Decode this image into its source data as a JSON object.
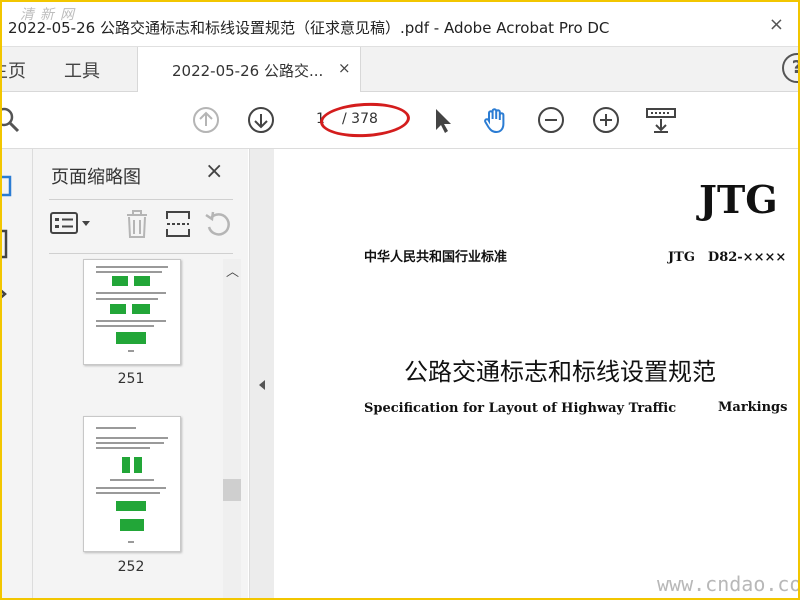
{
  "window": {
    "site_logo": "清新网",
    "title": "2022-05-26 公路交通标志和标线设置规范（征求意见稿）.pdf - Adobe Acrobat Pro DC",
    "close_symbol": "×"
  },
  "tabs": {
    "home": "主页",
    "tools": "工具",
    "document": "2022-05-26 公路交...",
    "close_symbol": "×",
    "help_symbol": "?"
  },
  "toolbar": {
    "page_current": "1",
    "page_total": "/ 378",
    "icons": [
      "search-icon",
      "prev-page-icon",
      "next-page-icon",
      "select-cursor-icon",
      "hand-tool-icon",
      "zoom-out-icon",
      "zoom-in-icon",
      "page-display-icon"
    ]
  },
  "thumbnails": {
    "title": "页面缩略图",
    "close_symbol": "×",
    "tools": [
      "options-menu-icon",
      "delete-icon",
      "extract-pages-icon",
      "rotate-icon"
    ],
    "pages": [
      {
        "label": "251"
      },
      {
        "label": "252"
      }
    ]
  },
  "document": {
    "logo": "JTG",
    "standard_class": "中华人民共和国行业标准",
    "standard_code": "JTG　D82-××××",
    "title_cn": "公路交通标志和标线设置规范",
    "title_en_1": "Specification for Layout of Highway Traffic",
    "title_en_2": "Markings"
  },
  "watermark": "www.cndao.com",
  "colors": {
    "accent_blue": "#2b7cd3",
    "annotation_red": "#d41d1d",
    "frame_yellow": "#f2c600",
    "thumb_green": "#22a638"
  }
}
